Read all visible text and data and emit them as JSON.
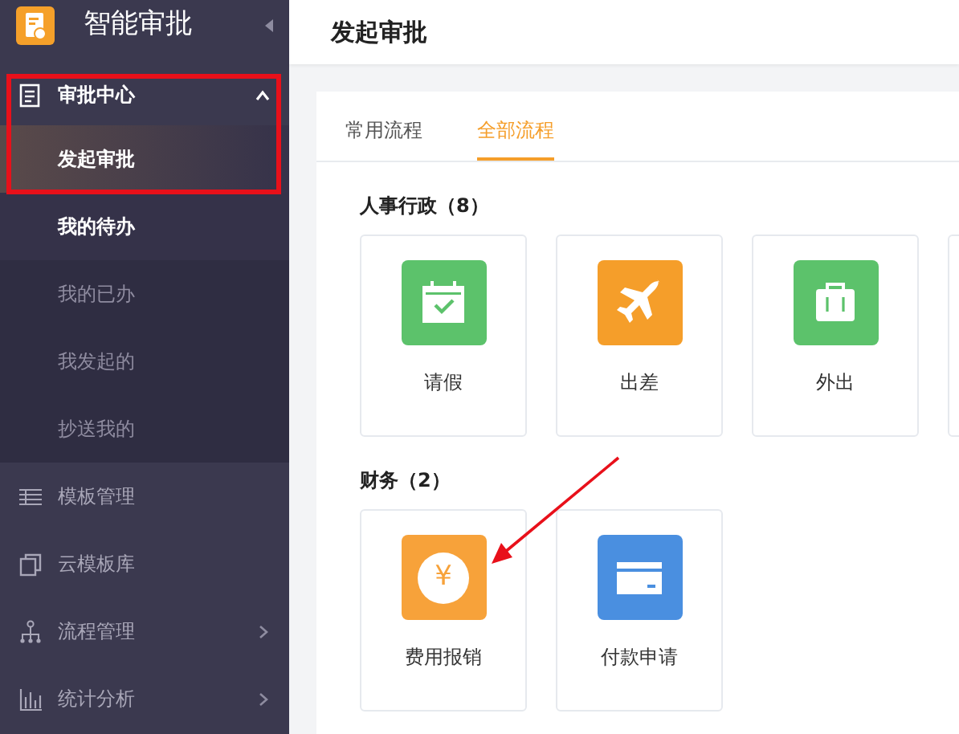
{
  "sidebar": {
    "app_title": "智能审批",
    "items": [
      {
        "label": "审批中心",
        "kind": "document",
        "expanded": true,
        "has_submenu": true,
        "children": [
          {
            "label": "发起审批",
            "selected": true,
            "highlighted": false
          },
          {
            "label": "我的待办",
            "selected": false,
            "highlighted": true
          },
          {
            "label": "我的已办",
            "selected": false,
            "highlighted": false
          },
          {
            "label": "我发起的",
            "selected": false,
            "highlighted": false
          },
          {
            "label": "抄送我的",
            "selected": false,
            "highlighted": false
          }
        ]
      },
      {
        "label": "模板管理",
        "kind": "list",
        "expanded": false,
        "has_submenu": false
      },
      {
        "label": "云模板库",
        "kind": "copies",
        "expanded": false,
        "has_submenu": false
      },
      {
        "label": "流程管理",
        "kind": "flow",
        "expanded": false,
        "has_submenu": true
      },
      {
        "label": "统计分析",
        "kind": "bars",
        "expanded": false,
        "has_submenu": true
      }
    ]
  },
  "header": {
    "title": "发起审批"
  },
  "tabs": [
    {
      "label": "常用流程",
      "selected": false
    },
    {
      "label": "全部流程",
      "selected": true
    }
  ],
  "sections": [
    {
      "title": "人事行政（8）",
      "tiles": [
        {
          "kind": "calendar",
          "label": "请假",
          "color": "#5cc26b"
        },
        {
          "kind": "plane",
          "label": "出差",
          "color": "#f59e2a"
        },
        {
          "kind": "suitcase",
          "label": "外出",
          "color": "#5cc26b"
        },
        {
          "kind": "blank"
        }
      ]
    },
    {
      "title": "财务（2）",
      "tiles": [
        {
          "kind": "coin",
          "label": "费用报销",
          "color": "#f7a23a",
          "glyph": "¥"
        },
        {
          "kind": "card",
          "label": "付款申请",
          "color": "#4a8fe0"
        }
      ]
    }
  ]
}
